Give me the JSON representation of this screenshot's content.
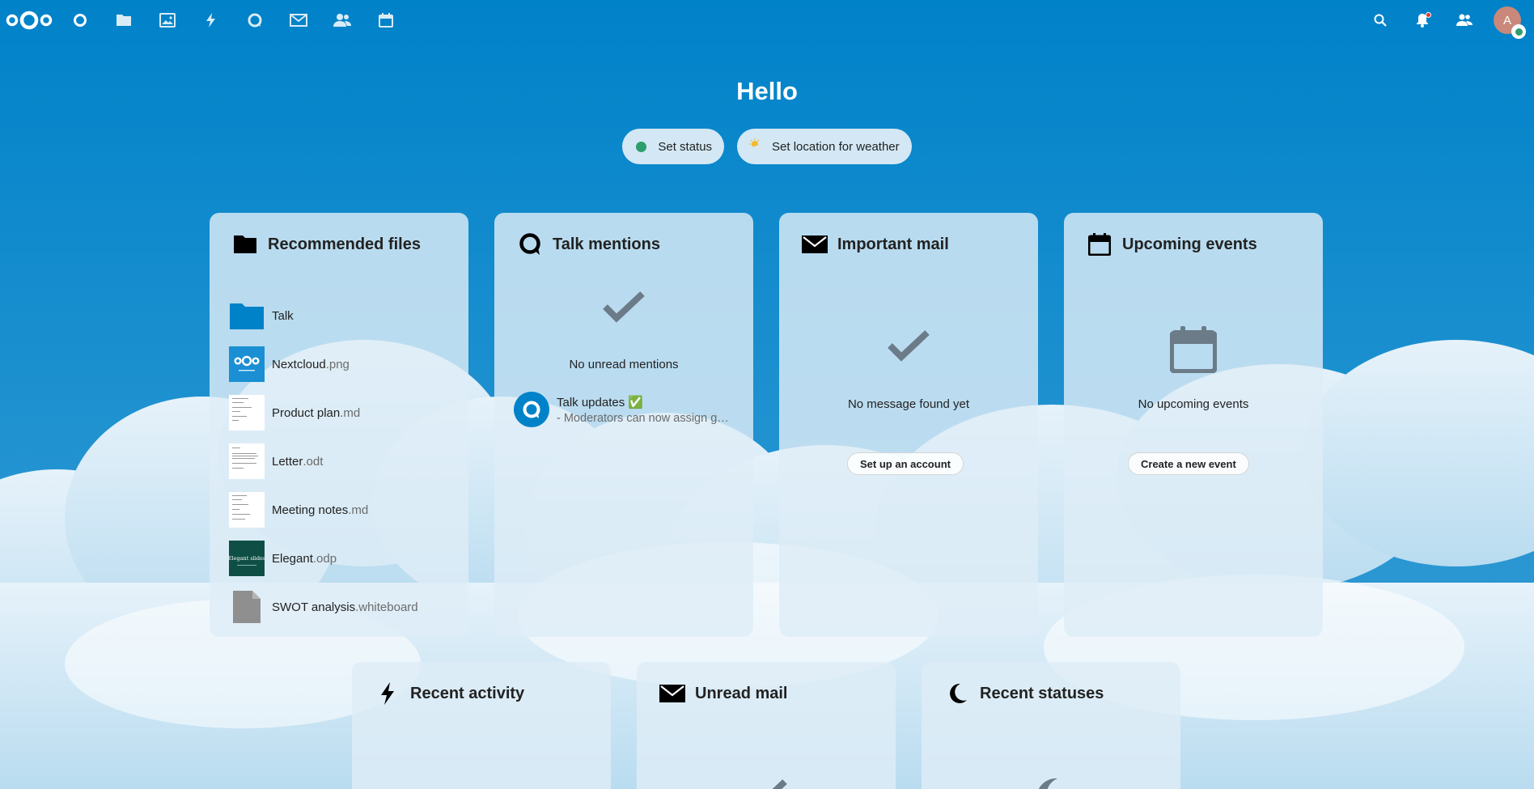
{
  "header": {
    "apps": [
      {
        "name": "dashboard",
        "icon": "dashboard-icon"
      },
      {
        "name": "files",
        "icon": "folder-icon"
      },
      {
        "name": "photos",
        "icon": "image-icon"
      },
      {
        "name": "activity",
        "icon": "lightning-icon"
      },
      {
        "name": "talk",
        "icon": "talk-icon"
      },
      {
        "name": "mail",
        "icon": "mail-icon"
      },
      {
        "name": "contacts",
        "icon": "contacts-icon"
      },
      {
        "name": "calendar",
        "icon": "calendar-icon"
      }
    ],
    "avatar_initial": "A"
  },
  "greeting": "Hello",
  "status": {
    "set_status": "Set status",
    "set_weather": "Set location for weather"
  },
  "panels": {
    "recommended": {
      "title": "Recommended files",
      "files": [
        {
          "name": "Talk",
          "ext": ""
        },
        {
          "name": "Nextcloud",
          "ext": ".png"
        },
        {
          "name": "Product plan",
          "ext": ".md"
        },
        {
          "name": "Letter",
          "ext": ".odt"
        },
        {
          "name": "Meeting notes",
          "ext": ".md"
        },
        {
          "name": "Elegant",
          "ext": ".odp"
        },
        {
          "name": "SWOT analysis",
          "ext": ".whiteboard"
        }
      ],
      "elegant_thumb_text": "Elegant slides"
    },
    "talk": {
      "title": "Talk mentions",
      "empty": "No unread mentions",
      "item_title": "Talk updates ✅",
      "item_sub": "- Moderators can now assign g…"
    },
    "important_mail": {
      "title": "Important mail",
      "empty": "No message found yet",
      "button": "Set up an account"
    },
    "events": {
      "title": "Upcoming events",
      "empty": "No upcoming events",
      "button": "Create a new event"
    },
    "activity": {
      "title": "Recent activity"
    },
    "unread_mail": {
      "title": "Unread mail"
    },
    "statuses": {
      "title": "Recent statuses"
    }
  },
  "colors": {
    "primary": "#0082c9",
    "status_online": "#2d9e6c",
    "notification": "#e9322d"
  }
}
